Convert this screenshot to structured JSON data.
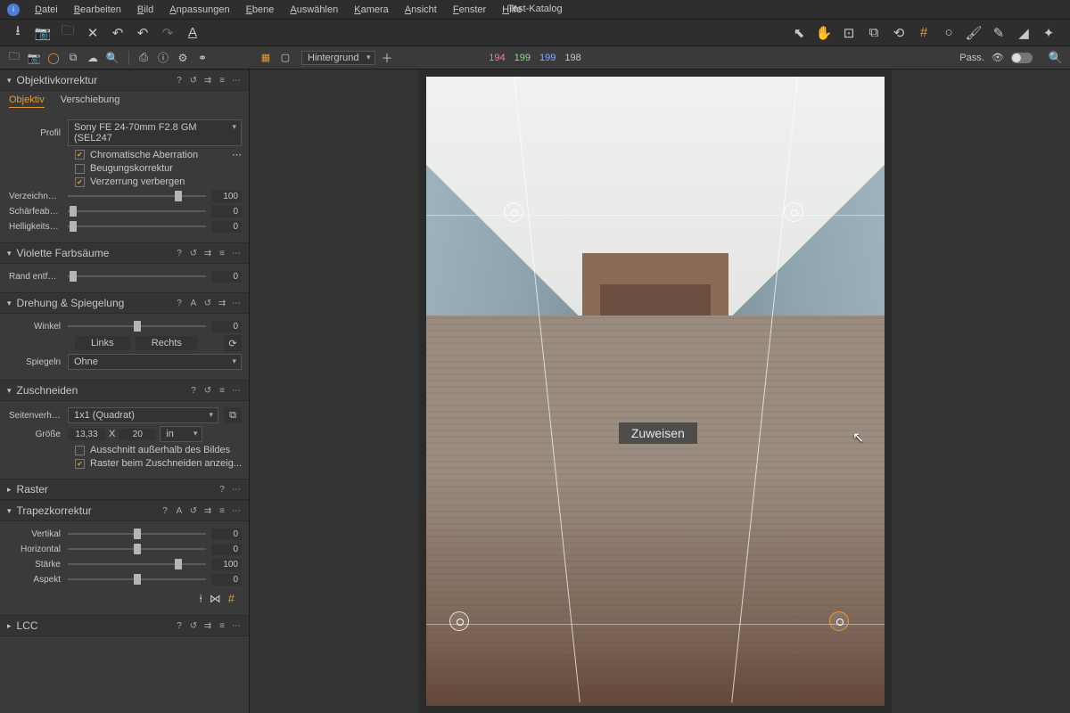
{
  "app": {
    "catalog_title": "Test-Katalog"
  },
  "menu": {
    "file": "Datei",
    "edit": "Bearbeiten",
    "image": "Bild",
    "adjust": "Anpassungen",
    "layer": "Ebene",
    "select": "Auswählen",
    "camera": "Kamera",
    "view": "Ansicht",
    "window": "Fenster",
    "help": "Hilfe"
  },
  "subbar": {
    "layer_select": "Hintergrund",
    "rgb": {
      "r": "194",
      "g": "199",
      "b": "199",
      "l": "198"
    },
    "pass_label": "Pass."
  },
  "panels": {
    "lens": {
      "title": "Objektivkorrektur",
      "tabs": {
        "lens": "Objektiv",
        "shift": "Verschiebung"
      },
      "profile_label": "Profil",
      "profile_value": "Sony FE 24-70mm F2.8 GM (SEL247",
      "chk_ca": "Chromatische Aberration",
      "chk_diff": "Beugungskorrektur",
      "chk_hidedist": "Verzerrung verbergen",
      "distortion_label": "Verzeichnung",
      "distortion_val": "100",
      "sharp_label": "Schärfeabfall",
      "sharp_val": "0",
      "light_label": "Helligkeitsa...",
      "light_val": "0"
    },
    "purple": {
      "title": "Violette Farbsäume",
      "edge_label": "Rand entfer...",
      "edge_val": "0"
    },
    "rotate": {
      "title": "Drehung & Spiegelung",
      "angle_label": "Winkel",
      "angle_val": "0",
      "btn_left": "Links",
      "btn_right": "Rechts",
      "flip_label": "Spiegeln",
      "flip_value": "Ohne"
    },
    "crop": {
      "title": "Zuschneiden",
      "ratio_label": "Seitenverhä...",
      "ratio_value": "1x1 (Quadrat)",
      "size_label": "Größe",
      "size_w": "13,33",
      "size_x": "X",
      "size_h": "20",
      "size_unit": "in",
      "chk_outside": "Ausschnitt außerhalb des Bildes",
      "chk_grid": "Raster beim Zuschneiden anzeig..."
    },
    "grid": {
      "title": "Raster"
    },
    "keystone": {
      "title": "Trapezkorrektur",
      "vertical_label": "Vertikal",
      "vertical_val": "0",
      "horizontal_label": "Horizontal",
      "horizontal_val": "0",
      "strength_label": "Stärke",
      "strength_val": "100",
      "aspect_label": "Aspekt",
      "aspect_val": "0"
    },
    "lcc": {
      "title": "LCC"
    }
  },
  "viewer": {
    "tooltip": "Zuweisen"
  }
}
